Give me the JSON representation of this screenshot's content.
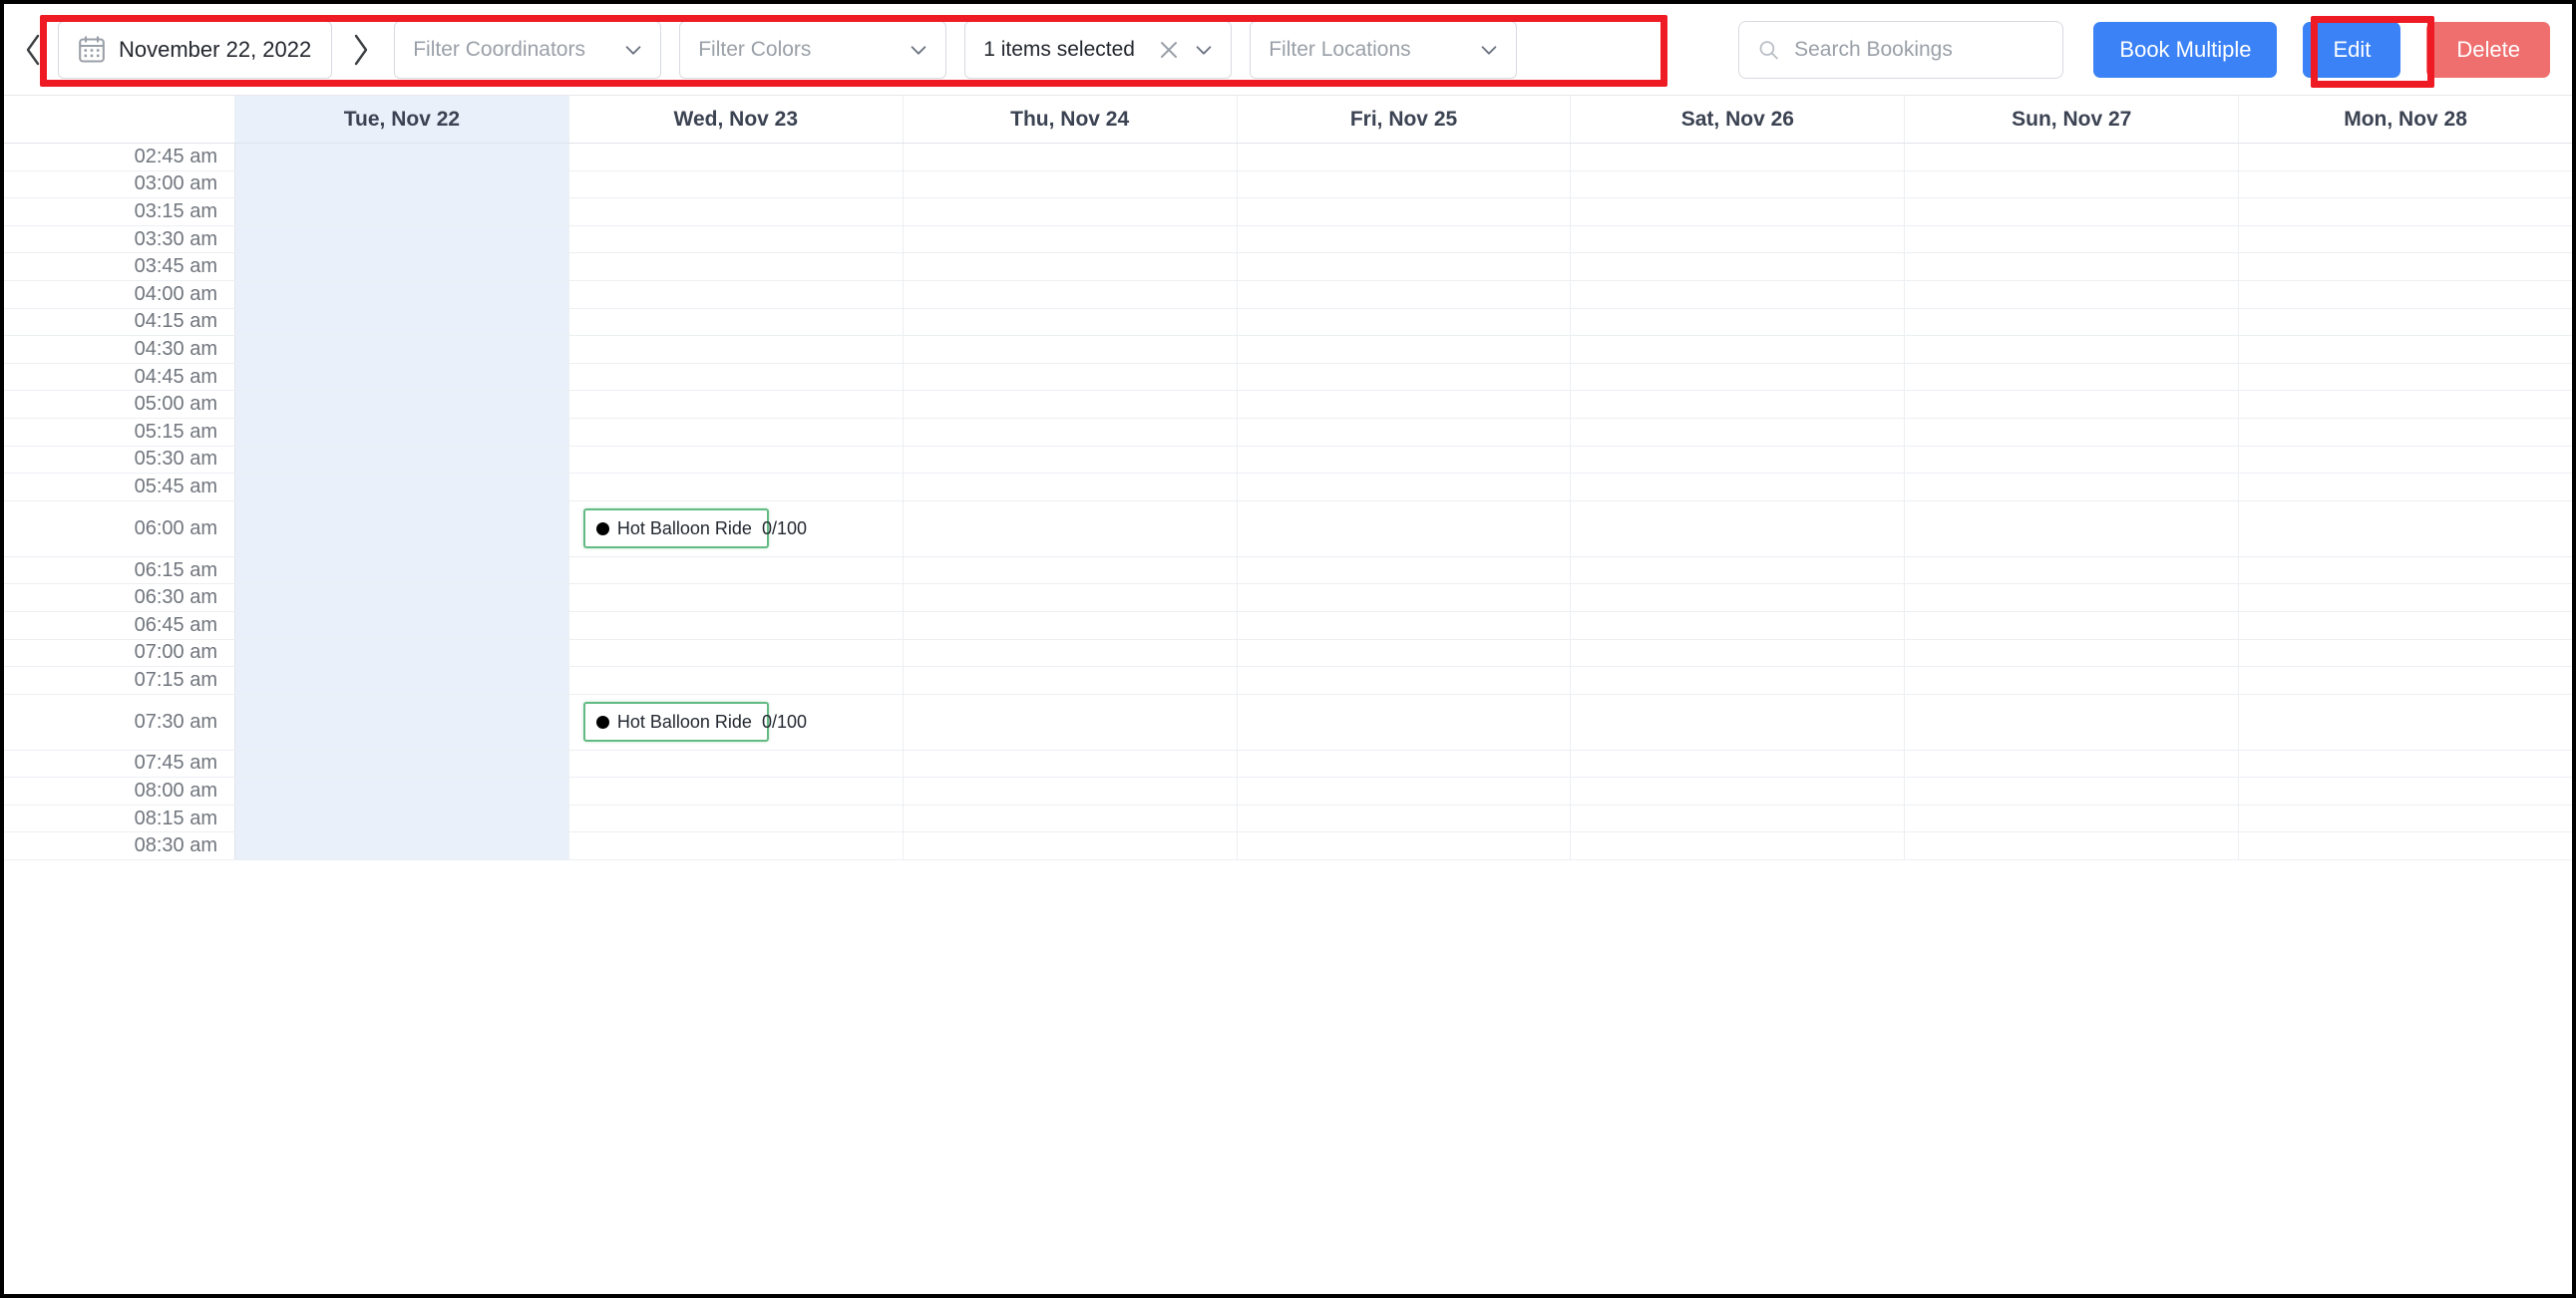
{
  "toolbar": {
    "prev_label": "‹",
    "next_label": "›",
    "date_value": "November 22, 2022",
    "calendar_icon": "calendar-icon",
    "filters": [
      {
        "name": "coordinators",
        "label": "Filter Coordinators",
        "selected": false,
        "clearable": false
      },
      {
        "name": "colors",
        "label": "Filter Colors",
        "selected": false,
        "clearable": false
      },
      {
        "name": "items",
        "label": "1 items selected",
        "selected": true,
        "clearable": true
      },
      {
        "name": "locations",
        "label": "Filter Locations",
        "selected": false,
        "clearable": false
      }
    ],
    "search": {
      "placeholder": "Search Bookings",
      "value": "",
      "icon": "search-icon"
    },
    "book_multiple_label": "Book Multiple",
    "edit_label": "Edit",
    "delete_label": "Delete",
    "colors": {
      "primary": "#3b82f6",
      "danger": "#ef6f6f",
      "annotation": "#ee1b24",
      "today_column": "#e9f0fa",
      "chip_border": "#63bb83"
    }
  },
  "calendar": {
    "gutter_header": "",
    "days": [
      {
        "label": "Tue, Nov 22",
        "today": true
      },
      {
        "label": "Wed, Nov 23",
        "today": false
      },
      {
        "label": "Thu, Nov 24",
        "today": false
      },
      {
        "label": "Fri, Nov 25",
        "today": false
      },
      {
        "label": "Sat, Nov 26",
        "today": false
      },
      {
        "label": "Sun, Nov 27",
        "today": false
      },
      {
        "label": "Mon, Nov 28",
        "today": false
      }
    ],
    "rows": [
      {
        "time": "02:45 am",
        "tall": false,
        "bookings": []
      },
      {
        "time": "03:00 am",
        "tall": false,
        "bookings": []
      },
      {
        "time": "03:15 am",
        "tall": false,
        "bookings": []
      },
      {
        "time": "03:30 am",
        "tall": false,
        "bookings": []
      },
      {
        "time": "03:45 am",
        "tall": false,
        "bookings": []
      },
      {
        "time": "04:00 am",
        "tall": false,
        "bookings": []
      },
      {
        "time": "04:15 am",
        "tall": false,
        "bookings": []
      },
      {
        "time": "04:30 am",
        "tall": false,
        "bookings": []
      },
      {
        "time": "04:45 am",
        "tall": false,
        "bookings": []
      },
      {
        "time": "05:00 am",
        "tall": false,
        "bookings": []
      },
      {
        "time": "05:15 am",
        "tall": false,
        "bookings": []
      },
      {
        "time": "05:30 am",
        "tall": false,
        "bookings": []
      },
      {
        "time": "05:45 am",
        "tall": false,
        "bookings": []
      },
      {
        "time": "06:00 am",
        "tall": true,
        "bookings": [
          {
            "day": 1,
            "title": "Hot Balloon Ride",
            "count": "0/100",
            "dot_color": "#000000",
            "border_color": "#63bb83"
          }
        ]
      },
      {
        "time": "06:15 am",
        "tall": false,
        "bookings": []
      },
      {
        "time": "06:30 am",
        "tall": false,
        "bookings": []
      },
      {
        "time": "06:45 am",
        "tall": false,
        "bookings": []
      },
      {
        "time": "07:00 am",
        "tall": false,
        "bookings": []
      },
      {
        "time": "07:15 am",
        "tall": false,
        "bookings": []
      },
      {
        "time": "07:30 am",
        "tall": true,
        "bookings": [
          {
            "day": 1,
            "title": "Hot Balloon Ride",
            "count": "0/100",
            "dot_color": "#000000",
            "border_color": "#63bb83"
          }
        ]
      },
      {
        "time": "07:45 am",
        "tall": false,
        "bookings": []
      },
      {
        "time": "08:00 am",
        "tall": false,
        "bookings": []
      },
      {
        "time": "08:15 am",
        "tall": false,
        "bookings": []
      },
      {
        "time": "08:30 am",
        "tall": false,
        "bookings": []
      }
    ]
  }
}
